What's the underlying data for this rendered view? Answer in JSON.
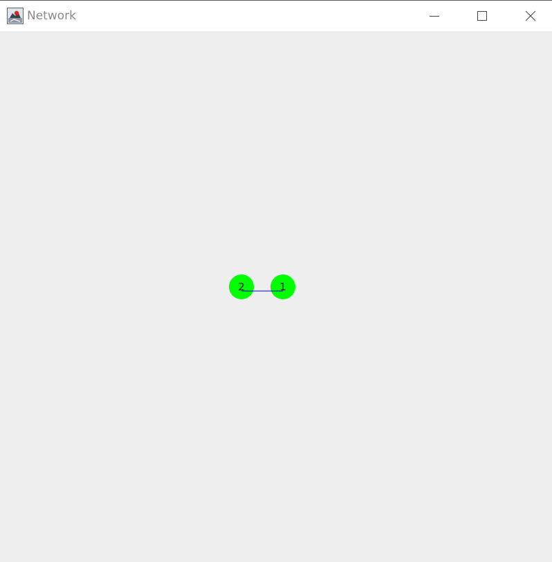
{
  "window": {
    "title": "Network",
    "icon": "java-app-icon",
    "controls": [
      "minimize-icon",
      "maximize-icon",
      "close-icon"
    ]
  },
  "colors": {
    "canvas_background": "#eeeeee",
    "node_fill": "#00ff00",
    "edge_color": "#0000cc",
    "label_color": "#000000"
  },
  "network": {
    "nodes": [
      {
        "id": "1",
        "label": "1"
      },
      {
        "id": "2",
        "label": "2"
      }
    ],
    "edges": [
      {
        "from": "2",
        "to": "1"
      }
    ]
  }
}
